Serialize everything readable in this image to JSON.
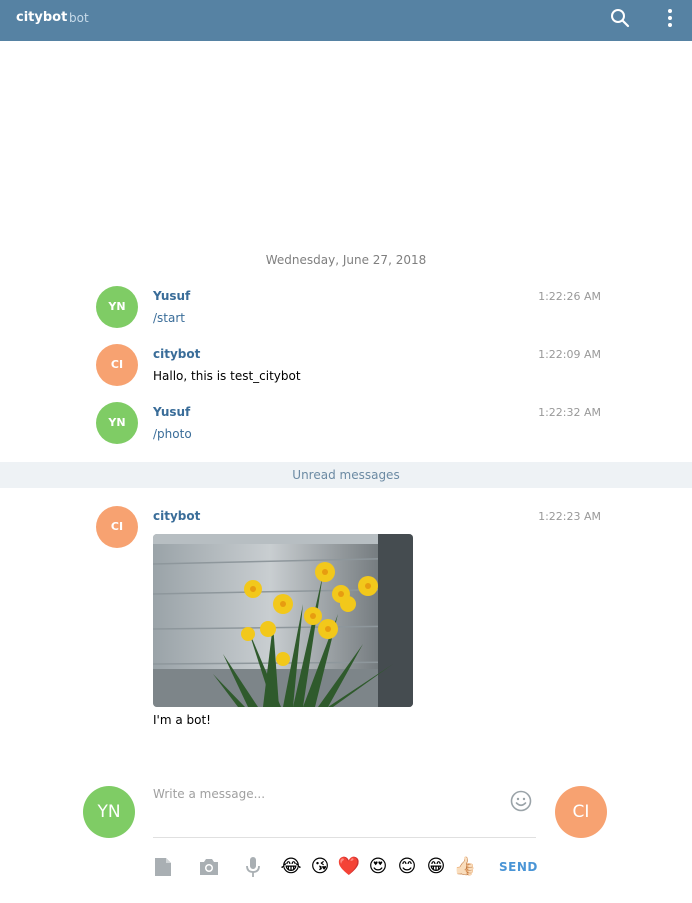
{
  "header": {
    "title": "citybot",
    "subtitle": "bot",
    "search_icon": "search-icon",
    "menu_icon": "more-vertical-icon"
  },
  "colors": {
    "header_bg": "#5682a3",
    "avatar_green": "#7fcc65",
    "avatar_orange": "#f7a271",
    "link_blue": "#3a6d99",
    "send_blue": "#4a95d6"
  },
  "chat": {
    "date_separator": "Wednesday, June 27, 2018",
    "unread_label": "Unread messages",
    "messages": [
      {
        "initials": "YN",
        "author": "Yusuf",
        "time": "1:22:26 AM",
        "text": "/start"
      },
      {
        "initials": "CI",
        "author": "citybot",
        "time": "1:22:09 AM",
        "text": "Hallo, this is test_citybot"
      },
      {
        "initials": "YN",
        "author": "Yusuf",
        "time": "1:22:32 AM",
        "text": "/photo"
      },
      {
        "initials": "CI",
        "author": "citybot",
        "time": "1:22:23 AM",
        "photo": "yellow daffodils photo",
        "caption": "I'm a bot!"
      }
    ]
  },
  "composer": {
    "placeholder": "Write a message...",
    "value": "",
    "left_avatar": "YN",
    "right_avatar": "CI",
    "tools": [
      "attach-file-icon",
      "camera-icon",
      "microphone-icon"
    ],
    "emojis": [
      "😂",
      "😘",
      "❤️",
      "😍",
      "😊",
      "😁",
      "👍🏻"
    ],
    "send_label": "SEND"
  }
}
